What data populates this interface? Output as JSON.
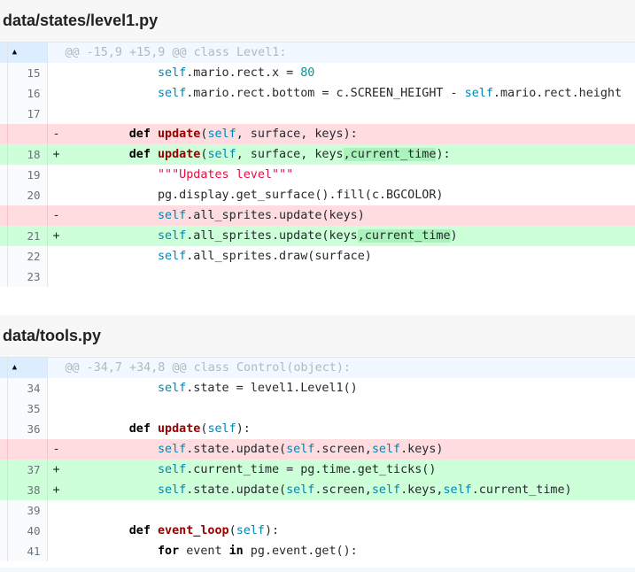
{
  "files": [
    {
      "path": "data/states/level1.py",
      "hunk": "@@ -15,9 +15,9 @@ class Level1:",
      "lines": [
        {
          "type": "ctx",
          "num": "15",
          "ind": "        ",
          "tok": [
            {
              "t": "self",
              "c": "sf"
            },
            {
              "t": ".mario.rect.x = "
            },
            {
              "t": "80",
              "c": "num"
            }
          ]
        },
        {
          "type": "ctx",
          "num": "16",
          "ind": "        ",
          "tok": [
            {
              "t": "self",
              "c": "sf"
            },
            {
              "t": ".mario.rect.bottom = c.SCREEN_HEIGHT - "
            },
            {
              "t": "self",
              "c": "sf"
            },
            {
              "t": ".mario.rect.height"
            }
          ]
        },
        {
          "type": "ctx",
          "num": "17",
          "ind": "",
          "tok": []
        },
        {
          "type": "del",
          "num": "",
          "sign": "-",
          "ind": "    ",
          "tok": [
            {
              "t": "def",
              "c": "kw"
            },
            {
              "t": " "
            },
            {
              "t": "update",
              "c": "fn"
            },
            {
              "t": "("
            },
            {
              "t": "self",
              "c": "sf"
            },
            {
              "t": ", surface, keys):"
            }
          ]
        },
        {
          "type": "add",
          "num": "18",
          "sign": "+",
          "ind": "    ",
          "tok": [
            {
              "t": "def",
              "c": "kw"
            },
            {
              "t": " "
            },
            {
              "t": "update",
              "c": "fn"
            },
            {
              "t": "("
            },
            {
              "t": "self",
              "c": "sf"
            },
            {
              "t": ", surface, keys"
            },
            {
              "t": ",current_time",
              "c": "hl"
            },
            {
              "t": "):"
            }
          ]
        },
        {
          "type": "ctx",
          "num": "19",
          "ind": "        ",
          "tok": [
            {
              "t": "\"\"\"Updates level\"\"\"",
              "c": "str"
            }
          ]
        },
        {
          "type": "ctx",
          "num": "20",
          "ind": "        ",
          "tok": [
            {
              "t": "pg.display.get_surface().fill(c.BGCOLOR)"
            }
          ]
        },
        {
          "type": "del",
          "num": "",
          "sign": "-",
          "ind": "        ",
          "tok": [
            {
              "t": "self",
              "c": "sf"
            },
            {
              "t": ".all_sprites.update(keys)"
            }
          ]
        },
        {
          "type": "add",
          "num": "21",
          "sign": "+",
          "ind": "        ",
          "tok": [
            {
              "t": "self",
              "c": "sf"
            },
            {
              "t": ".all_sprites.update(keys"
            },
            {
              "t": ",current_time",
              "c": "hl"
            },
            {
              "t": ")"
            }
          ]
        },
        {
          "type": "ctx",
          "num": "22",
          "ind": "        ",
          "tok": [
            {
              "t": "self",
              "c": "sf"
            },
            {
              "t": ".all_sprites.draw(surface)"
            }
          ]
        },
        {
          "type": "ctx",
          "num": "23",
          "ind": "",
          "tok": []
        }
      ]
    },
    {
      "path": "data/tools.py",
      "hunk": "@@ -34,7 +34,8 @@ class Control(object):",
      "lines": [
        {
          "type": "ctx",
          "num": "34",
          "ind": "        ",
          "tok": [
            {
              "t": "self",
              "c": "sf"
            },
            {
              "t": ".state = level1.Level1()"
            }
          ]
        },
        {
          "type": "ctx",
          "num": "35",
          "ind": "",
          "tok": []
        },
        {
          "type": "ctx",
          "num": "36",
          "ind": "    ",
          "tok": [
            {
              "t": "def",
              "c": "kw"
            },
            {
              "t": " "
            },
            {
              "t": "update",
              "c": "fn"
            },
            {
              "t": "("
            },
            {
              "t": "self",
              "c": "sf"
            },
            {
              "t": "):"
            }
          ]
        },
        {
          "type": "del",
          "num": "",
          "sign": "-",
          "ind": "        ",
          "tok": [
            {
              "t": "self",
              "c": "sf"
            },
            {
              "t": ".state.update("
            },
            {
              "t": "self",
              "c": "sf"
            },
            {
              "t": ".screen,"
            },
            {
              "t": "self",
              "c": "sf"
            },
            {
              "t": ".keys)"
            }
          ]
        },
        {
          "type": "add",
          "num": "37",
          "sign": "+",
          "ind": "        ",
          "tok": [
            {
              "t": "self",
              "c": "sf"
            },
            {
              "t": ".current_time = pg.time.get_ticks()"
            }
          ]
        },
        {
          "type": "add",
          "num": "38",
          "sign": "+",
          "ind": "        ",
          "tok": [
            {
              "t": "self",
              "c": "sf"
            },
            {
              "t": ".state.update("
            },
            {
              "t": "self",
              "c": "sf"
            },
            {
              "t": ".screen,"
            },
            {
              "t": "self",
              "c": "sf"
            },
            {
              "t": ".keys,"
            },
            {
              "t": "self",
              "c": "sf"
            },
            {
              "t": ".current_time)"
            }
          ]
        },
        {
          "type": "ctx",
          "num": "39",
          "ind": "",
          "tok": []
        },
        {
          "type": "ctx",
          "num": "40",
          "ind": "    ",
          "tok": [
            {
              "t": "def",
              "c": "kw"
            },
            {
              "t": " "
            },
            {
              "t": "event_loop",
              "c": "fn"
            },
            {
              "t": "("
            },
            {
              "t": "self",
              "c": "sf"
            },
            {
              "t": "):"
            }
          ]
        },
        {
          "type": "ctx",
          "num": "41",
          "ind": "        ",
          "tok": [
            {
              "t": "for",
              "c": "kw"
            },
            {
              "t": " event "
            },
            {
              "t": "in",
              "c": "kw"
            },
            {
              "t": " pg.event.get():"
            }
          ]
        }
      ]
    }
  ],
  "icons": {
    "expand_up": "▲"
  }
}
